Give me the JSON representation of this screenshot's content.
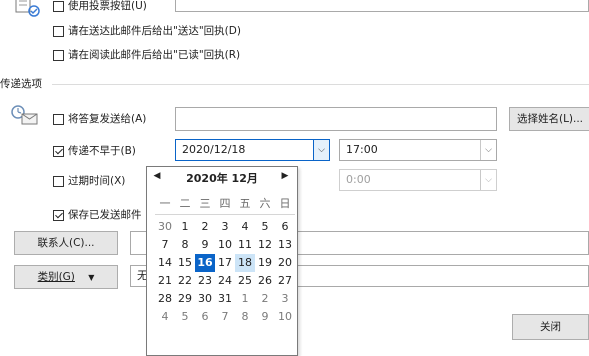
{
  "top": {
    "voting_label": "使用投票按钮(U)",
    "voting_value": "",
    "delivery_receipt_label": "请在送达此邮件后给出\"送达\"回执(D)",
    "read_receipt_label": "请在阅读此邮件后给出\"已读\"回执(R)"
  },
  "delivery": {
    "section_title": "传递选项",
    "reply_to_label": "将答复发送给(A)",
    "reply_to_value": "",
    "select_names_button": "选择姓名(L)...",
    "defer_label": "传递不早于(B)",
    "defer_checked": true,
    "defer_date": "2020/12/18",
    "defer_time": "17:00",
    "expire_label": "过期时间(X)",
    "expire_checked": false,
    "expire_time": "0:00",
    "save_sent_label": "保存已发送邮件",
    "save_sent_checked": true
  },
  "buttons": {
    "contacts": "联系人(C)...",
    "categories": "类别(G)",
    "category_value": "无",
    "close": "关闭"
  },
  "calendar": {
    "title": "2020年 12月",
    "prev_icon": "◀",
    "next_icon": "▶",
    "weekdays": [
      "一",
      "二",
      "三",
      "四",
      "五",
      "六",
      "日"
    ],
    "weeks": [
      [
        {
          "d": "30",
          "o": true
        },
        {
          "d": "1"
        },
        {
          "d": "2"
        },
        {
          "d": "3"
        },
        {
          "d": "4"
        },
        {
          "d": "5"
        },
        {
          "d": "6"
        }
      ],
      [
        {
          "d": "7"
        },
        {
          "d": "8"
        },
        {
          "d": "9"
        },
        {
          "d": "10"
        },
        {
          "d": "11"
        },
        {
          "d": "12"
        },
        {
          "d": "13"
        }
      ],
      [
        {
          "d": "14"
        },
        {
          "d": "15"
        },
        {
          "d": "16",
          "s": true
        },
        {
          "d": "17"
        },
        {
          "d": "18",
          "t": true
        },
        {
          "d": "19"
        },
        {
          "d": "20"
        }
      ],
      [
        {
          "d": "21"
        },
        {
          "d": "22"
        },
        {
          "d": "23"
        },
        {
          "d": "24"
        },
        {
          "d": "25"
        },
        {
          "d": "26"
        },
        {
          "d": "27"
        }
      ],
      [
        {
          "d": "28"
        },
        {
          "d": "29"
        },
        {
          "d": "30"
        },
        {
          "d": "31"
        },
        {
          "d": "1",
          "o": true
        },
        {
          "d": "2",
          "o": true
        },
        {
          "d": "3",
          "o": true
        }
      ],
      [
        {
          "d": "4",
          "o": true
        },
        {
          "d": "5",
          "o": true
        },
        {
          "d": "6",
          "o": true
        },
        {
          "d": "7",
          "o": true
        },
        {
          "d": "8",
          "o": true
        },
        {
          "d": "9",
          "o": true
        },
        {
          "d": "10",
          "o": true
        }
      ]
    ]
  },
  "colors": {
    "accent": "#0a64c8",
    "today_highlight": "#cce4f7"
  }
}
